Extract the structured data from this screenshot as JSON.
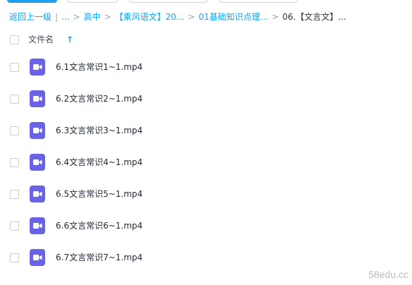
{
  "breadcrumb": {
    "back_label": "返回上一级",
    "items": [
      "...",
      "高中",
      "【乘风语文】20...",
      "01基础知识点理...",
      "06.【文言文】..."
    ]
  },
  "list_header": {
    "column_label": "文件名",
    "sort_icon": "arrow-up-icon",
    "sort_glyph": "↑"
  },
  "files": [
    {
      "name": "6.1文言常识1~1.mp4",
      "icon": "video-file-icon"
    },
    {
      "name": "6.2文言常识2~1.mp4",
      "icon": "video-file-icon"
    },
    {
      "name": "6.3文言常识3~1.mp4",
      "icon": "video-file-icon"
    },
    {
      "name": "6.4文言常识4~1.mp4",
      "icon": "video-file-icon"
    },
    {
      "name": "6.5文言常识5~1.mp4",
      "icon": "video-file-icon"
    },
    {
      "name": "6.6文言常识6~1.mp4",
      "icon": "video-file-icon"
    },
    {
      "name": "6.7文言常识7~1.mp4",
      "icon": "video-file-icon"
    }
  ],
  "watermark": "58edu.cc",
  "colors": {
    "link": "#06a7ff",
    "video_icon": "#6b63e6",
    "text": "#1f2733"
  }
}
